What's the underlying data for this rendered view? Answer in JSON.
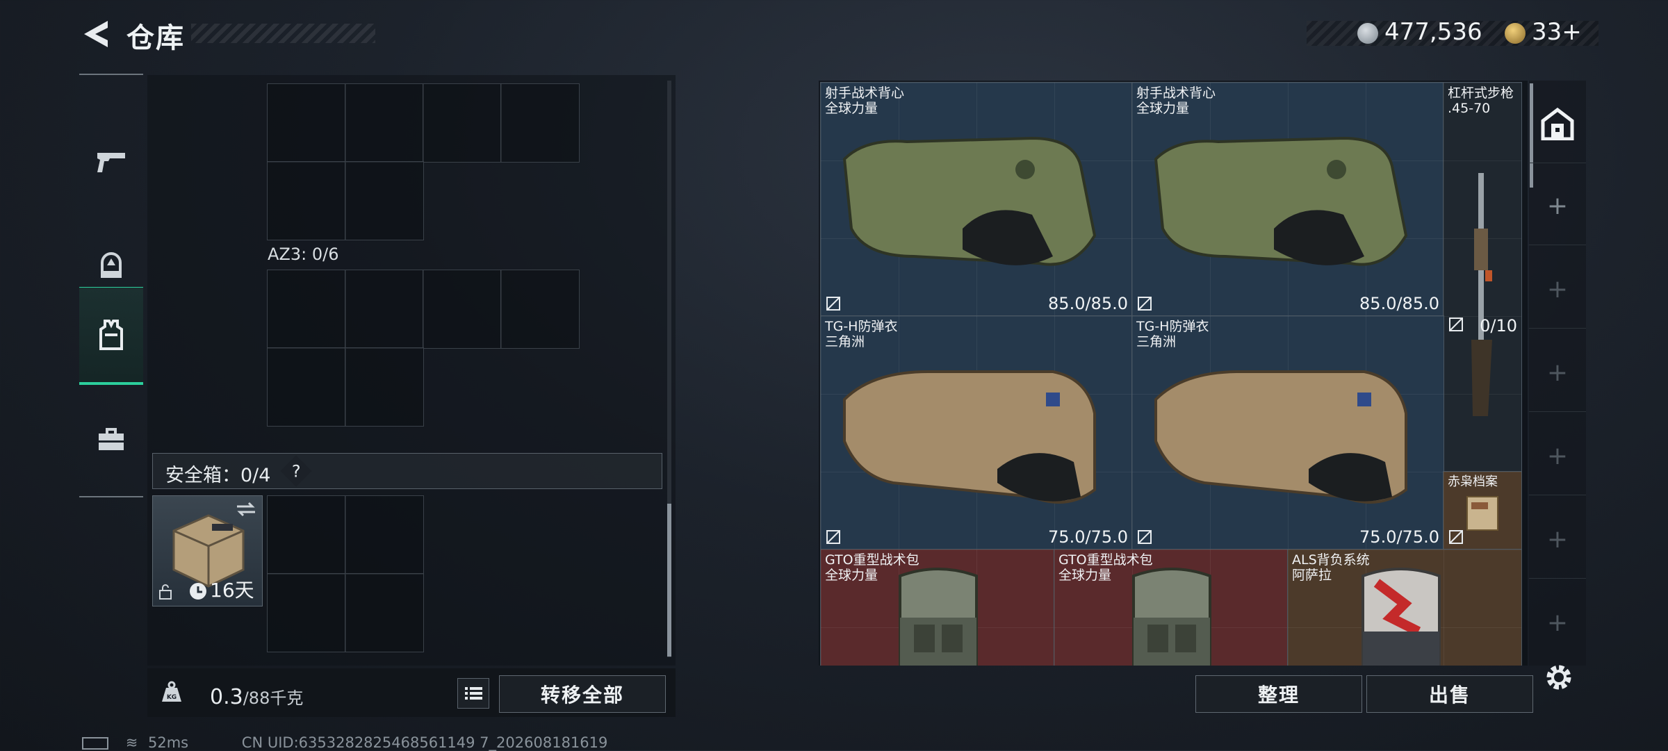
{
  "header": {
    "title": "仓库"
  },
  "currency": {
    "silver": "477,536",
    "gold": "33+"
  },
  "icons": {
    "back": "back-arrow-icon",
    "pistol": "pistol-icon",
    "helmet": "helmet-icon",
    "vest": "vest-icon",
    "briefcase": "briefcase-icon",
    "kg": "kg-icon",
    "list": "list-icon",
    "lock": "lock-icon",
    "clock": "clock-icon",
    "swap": "swap-icon",
    "settings": "gear-icon",
    "armor": "armor-icon"
  },
  "containers": {
    "az3_label": "AZ3: 0/6"
  },
  "safebox": {
    "label": "安全箱：0/4",
    "help": "?",
    "days": "16天"
  },
  "bottom": {
    "weight": "0.3",
    "weight_unit": "/88千克",
    "transfer_all": "转移全部"
  },
  "status": {
    "ping": "52ms",
    "uid": "CN UID:6353282825468561149 7_202608181619"
  },
  "stash": {
    "items": [
      {
        "name": "射手战术背心",
        "sub": "全球力量",
        "durability": "85.0/85.0"
      },
      {
        "name": "射手战术背心",
        "sub": "全球力量",
        "durability": "85.0/85.0"
      },
      {
        "name": "杠杆式步枪",
        "sub": ".45-70",
        "durability": ""
      },
      {
        "name": "TG-H防弹衣",
        "sub": "三角洲",
        "durability": "75.0/75.0"
      },
      {
        "name": "TG-H防弹衣",
        "sub": "三角洲",
        "durability": "75.0/75.0"
      },
      {
        "name": "",
        "sub": "",
        "durability": "0/10"
      },
      {
        "name": "赤枭档案",
        "sub": "",
        "durability": ""
      },
      {
        "name": "GTO重型战术包",
        "sub": "全球力量",
        "durability": ""
      },
      {
        "name": "GTO重型战术包",
        "sub": "全球力量",
        "durability": ""
      },
      {
        "name": "ALS背负系统",
        "sub": "阿萨拉",
        "durability": ""
      }
    ],
    "sort_btn": "整理",
    "sell_btn": "出售"
  },
  "colors": {
    "accent": "#2ccf9c",
    "blue_rarity": "#25384b",
    "red_rarity": "#5a2a2c"
  }
}
